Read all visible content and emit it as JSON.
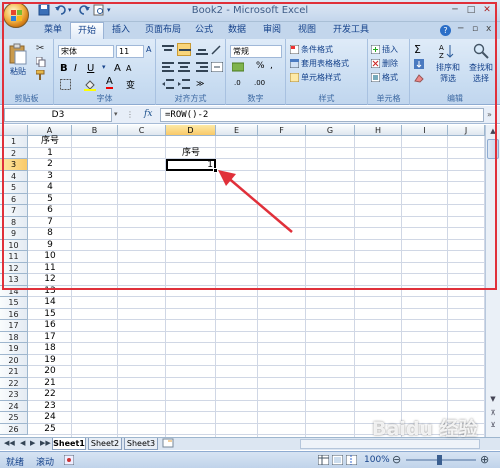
{
  "title_bar": {
    "title": "Book2 - Microsoft Excel"
  },
  "tabs": [
    {
      "label": "菜单"
    },
    {
      "label": "开始"
    },
    {
      "label": "插入"
    },
    {
      "label": "页面布局"
    },
    {
      "label": "公式"
    },
    {
      "label": "数据"
    },
    {
      "label": "审阅"
    },
    {
      "label": "视图"
    },
    {
      "label": "开发工具"
    }
  ],
  "ribbon": {
    "clipboard": {
      "paste": "粘贴",
      "label": "剪贴板"
    },
    "font": {
      "name": "宋体",
      "size": "11",
      "label": "字体"
    },
    "align": {
      "label": "对齐方式"
    },
    "number": {
      "format": "常规",
      "label": "数字"
    },
    "styles": {
      "cond": "条件格式",
      "table": "套用表格格式",
      "cell": "单元格样式",
      "label": "样式"
    },
    "cells": {
      "insert": "插入",
      "delete": "删除",
      "format": "格式",
      "label": "单元格"
    },
    "editing": {
      "sort": "排序和",
      "sort2": "筛选",
      "find": "查找和",
      "find2": "选择",
      "label": "编辑"
    }
  },
  "formula_bar": {
    "name_box": "D3",
    "fx": "fx",
    "formula": "=ROW()-2"
  },
  "columns": [
    "A",
    "B",
    "C",
    "D",
    "E",
    "F",
    "G",
    "H",
    "I",
    "J"
  ],
  "rows": [
    "1",
    "2",
    "3",
    "4",
    "5",
    "6",
    "7",
    "8",
    "9",
    "10",
    "11",
    "12",
    "13",
    "14",
    "15",
    "16",
    "17",
    "18",
    "19",
    "20",
    "21",
    "22",
    "23",
    "24",
    "25",
    "26"
  ],
  "col_a": [
    "序号",
    "1",
    "2",
    "3",
    "4",
    "5",
    "6",
    "7",
    "8",
    "9",
    "10",
    "11",
    "12",
    "13",
    "14",
    "15",
    "16",
    "17",
    "18",
    "19",
    "20",
    "21",
    "22",
    "23",
    "24",
    "25"
  ],
  "d2": "序号",
  "d3": "1",
  "sheets": [
    "Sheet1",
    "Sheet2",
    "Sheet3"
  ],
  "status": {
    "ready": "就绪",
    "scroll": "滚动",
    "zoom": "100%"
  },
  "watermark": "Baidu 经验",
  "colors": {
    "annotation": "#e0303a",
    "accent": "#15428b"
  }
}
